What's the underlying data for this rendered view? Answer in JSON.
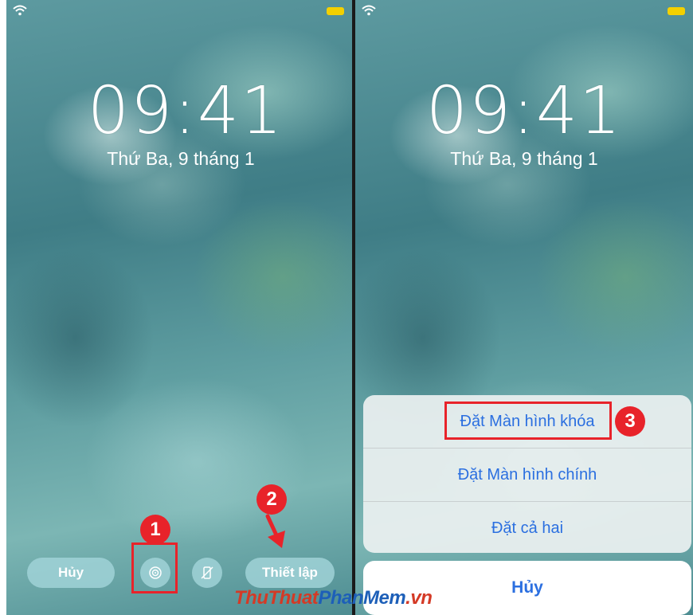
{
  "left_screen": {
    "time": "09:41",
    "date": "Thứ Ba, 9 tháng 1",
    "cancel_button": "Hủy",
    "set_button": "Thiết lập",
    "icons": [
      "wifi-icon",
      "battery-icon",
      "perspective-zoom-icon",
      "rotation-lock-icon"
    ]
  },
  "right_screen": {
    "time": "09:41",
    "date": "Thứ Ba, 9 tháng 1",
    "options": [
      "Đặt Màn hình khóa",
      "Đặt Màn hình chính",
      "Đặt cả hai"
    ],
    "cancel_button": "Hủy"
  },
  "annotations": {
    "step1": "1",
    "step2": "2",
    "step3": "3",
    "highlight_color": "#e8232a"
  },
  "watermark": {
    "part1": "ThuThuat",
    "part2": "PhanMem",
    "part3": ".vn"
  },
  "colors": {
    "accent_blue": "#2b6fe0",
    "battery": "#f4d000"
  }
}
